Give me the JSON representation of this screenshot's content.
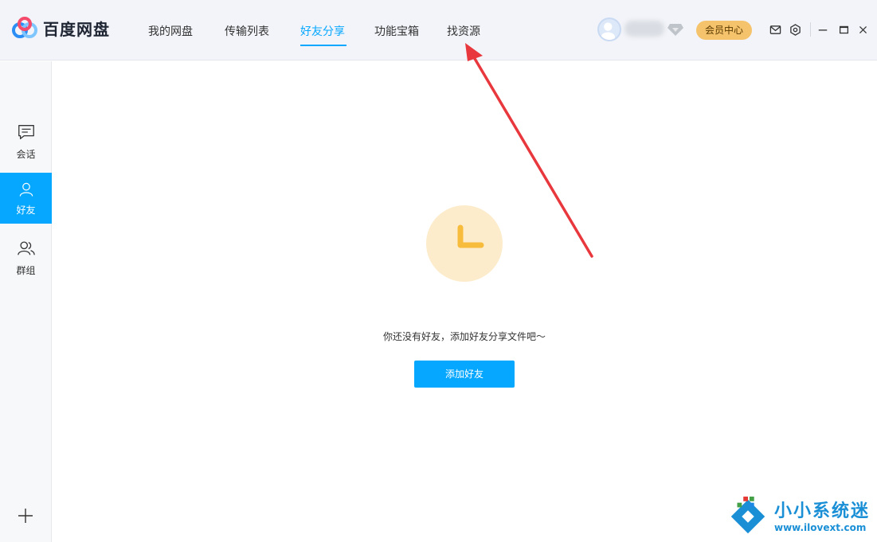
{
  "app": {
    "name": "百度网盘"
  },
  "nav": {
    "tabs": [
      {
        "label": "我的网盘"
      },
      {
        "label": "传输列表"
      },
      {
        "label": "好友分享",
        "active": true
      },
      {
        "label": "功能宝箱"
      },
      {
        "label": "找资源"
      }
    ]
  },
  "account": {
    "vip_label": "会员中心"
  },
  "icons": {
    "mail": "mail-icon",
    "settings": "gear-icon",
    "minimize": "minimize-icon",
    "maximize": "maximize-icon",
    "close": "close-icon"
  },
  "sidebar": {
    "items": [
      {
        "label": "会话",
        "icon": "chat-icon"
      },
      {
        "label": "好友",
        "icon": "person-icon",
        "active": true
      },
      {
        "label": "群组",
        "icon": "group-icon"
      }
    ],
    "add_icon": "plus-icon"
  },
  "main": {
    "empty_text": "你还没有好友，添加好友分享文件吧～",
    "add_friend_label": "添加好友"
  },
  "watermark": {
    "title": "小小系统迷",
    "url": "www.ilovext.com"
  },
  "colors": {
    "accent": "#06a7ff",
    "vip": "#f5c36b",
    "arrow": "#e8383d",
    "empty_icon_bg": "#fdeccb",
    "empty_icon_fg": "#f8bc3c"
  }
}
